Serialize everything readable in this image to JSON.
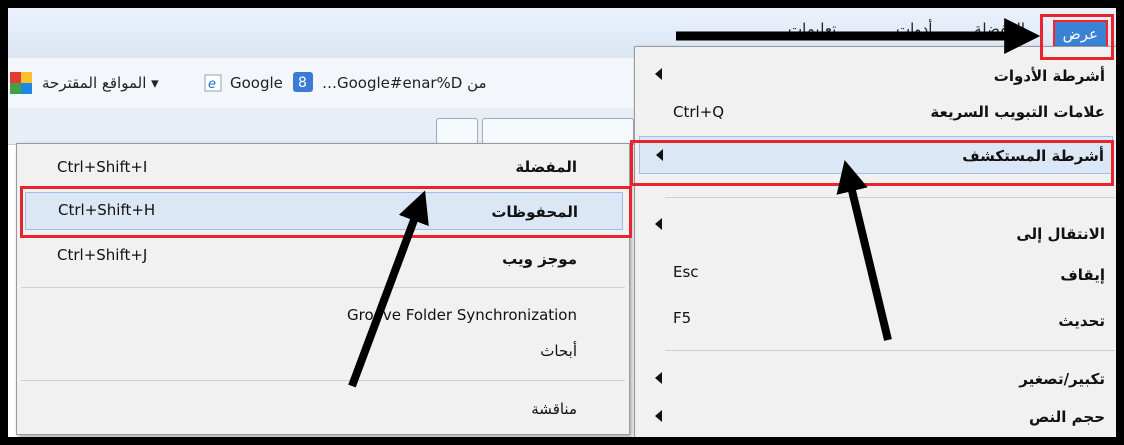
{
  "menubar": {
    "items": [
      {
        "label": "عرض",
        "active": true
      },
      {
        "label": "المفضلة"
      },
      {
        "label": "أدوات"
      },
      {
        "label": "تعليمات"
      }
    ]
  },
  "favorites_bar": {
    "suggested_sites": "المواقع المقترحة ▾",
    "google_link": "Google",
    "tab_link": "…Google#enar%D من"
  },
  "view_menu": {
    "items": [
      {
        "label": "أشرطة الأدوات",
        "shortcut": "",
        "submenu": true
      },
      {
        "label": "علامات التبويب السريعة",
        "shortcut": "Ctrl+Q",
        "submenu": false
      },
      {
        "label": "أشرطة المستكشف",
        "shortcut": "",
        "submenu": true,
        "highlighted": true
      },
      {
        "label": "الانتقال إلى",
        "shortcut": "",
        "submenu": true
      },
      {
        "label": "إيقاف",
        "shortcut": "Esc",
        "submenu": false
      },
      {
        "label": "تحديث",
        "shortcut": "F5",
        "submenu": false
      },
      {
        "label": "تكبير/تصغير",
        "shortcut": "",
        "submenu": true
      },
      {
        "label": "حجم النص",
        "shortcut": "",
        "submenu": true
      }
    ]
  },
  "explorer_submenu": {
    "items": [
      {
        "label": "المفضلة",
        "shortcut": "Ctrl+Shift+I"
      },
      {
        "label": "المحفوظات",
        "shortcut": "Ctrl+Shift+H",
        "highlighted": true
      },
      {
        "label": "موجز ويب",
        "shortcut": "Ctrl+Shift+J"
      },
      {
        "label": "Groove Folder Synchronization",
        "shortcut": ""
      },
      {
        "label": "أبحاث",
        "shortcut": ""
      },
      {
        "label": "مناقشة",
        "shortcut": ""
      }
    ]
  },
  "colors": {
    "highlight_box": "#e6262c",
    "menu_active": "#3b82d6",
    "arrow": "#000000"
  }
}
